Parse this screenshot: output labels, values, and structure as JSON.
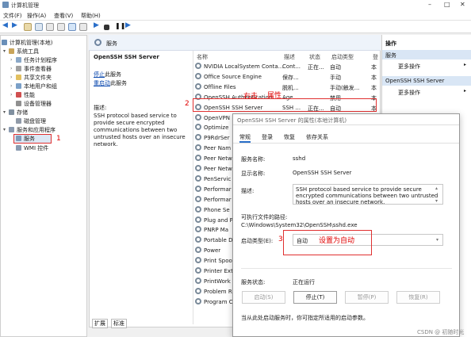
{
  "window": {
    "title": "计算机管理"
  },
  "menu": [
    "文件(F)",
    "操作(A)",
    "查看(V)",
    "帮助(H)"
  ],
  "tree": {
    "root": "计算机管理(本地)",
    "system_tools": "系统工具",
    "task_scheduler": "任务计划程序",
    "event_viewer": "事件查看器",
    "shared_folders": "共享文件夹",
    "local_users": "本地用户和组",
    "performance": "性能",
    "device_manager": "设备管理器",
    "storage": "存储",
    "disk_management": "磁盘管理",
    "services_apps": "服务和应用程序",
    "services": "服务",
    "wmi": "WMI 控件"
  },
  "center": {
    "header": "服务",
    "service_name": "OpenSSH SSH Server",
    "stop_link": "停止",
    "stop_suffix": "此服务",
    "restart_link": "重启动",
    "restart_suffix": "此服务",
    "desc_label": "描述:",
    "desc_text": "SSH protocol based service to provide secure encrypted communications between two untrusted hosts over an insecure network.",
    "columns": [
      "名称",
      "描述",
      "状态",
      "启动类型",
      "登"
    ],
    "rows": [
      {
        "name": "NVIDIA LocalSystem Conta...",
        "desc": "Cont...",
        "status": "正在...",
        "startup": "自动",
        "logon": "本"
      },
      {
        "name": "Office Source Engine",
        "desc": "保存...",
        "status": "",
        "startup": "手动",
        "logon": "本"
      },
      {
        "name": "Offline Files",
        "desc": "脱机...",
        "status": "",
        "startup": "手动(触发...",
        "logon": "本"
      },
      {
        "name": "OpenSSH Authentication...",
        "desc": "Age...",
        "status": "",
        "startup": "禁用",
        "logon": "本"
      },
      {
        "name": "OpenSSH SSH Server",
        "desc": "SSH ...",
        "status": "正在...",
        "startup": "自动",
        "logon": "本"
      },
      {
        "name": "OpenVPN",
        "desc": "",
        "status": "",
        "startup": "",
        "logon": ""
      },
      {
        "name": "Optimize",
        "desc": "",
        "status": "",
        "startup": "",
        "logon": ""
      },
      {
        "name": "P9RdrSer",
        "desc": "",
        "status": "",
        "startup": "",
        "logon": ""
      },
      {
        "name": "Peer Nam",
        "desc": "",
        "status": "",
        "startup": "",
        "logon": ""
      },
      {
        "name": "Peer Netw",
        "desc": "",
        "status": "",
        "startup": "",
        "logon": ""
      },
      {
        "name": "Peer Netw",
        "desc": "",
        "status": "",
        "startup": "",
        "logon": ""
      },
      {
        "name": "PenServic",
        "desc": "",
        "status": "",
        "startup": "",
        "logon": ""
      },
      {
        "name": "Performar",
        "desc": "",
        "status": "",
        "startup": "",
        "logon": ""
      },
      {
        "name": "Performar",
        "desc": "",
        "status": "",
        "startup": "",
        "logon": ""
      },
      {
        "name": "Phone Se",
        "desc": "",
        "status": "",
        "startup": "",
        "logon": ""
      },
      {
        "name": "Plug and P",
        "desc": "",
        "status": "",
        "startup": "",
        "logon": ""
      },
      {
        "name": "PNRP Ma",
        "desc": "",
        "status": "",
        "startup": "",
        "logon": ""
      },
      {
        "name": "Portable D",
        "desc": "",
        "status": "",
        "startup": "",
        "logon": ""
      },
      {
        "name": "Power",
        "desc": "",
        "status": "",
        "startup": "",
        "logon": ""
      },
      {
        "name": "Print Spoo",
        "desc": "",
        "status": "",
        "startup": "",
        "logon": ""
      },
      {
        "name": "Printer Ext",
        "desc": "",
        "status": "",
        "startup": "",
        "logon": ""
      },
      {
        "name": "PrintWork",
        "desc": "",
        "status": "",
        "startup": "",
        "logon": ""
      },
      {
        "name": "Problem R",
        "desc": "",
        "status": "",
        "startup": "",
        "logon": ""
      },
      {
        "name": "Program C",
        "desc": "",
        "status": "",
        "startup": "",
        "logon": ""
      }
    ],
    "tabs": [
      "扩展",
      "标准"
    ]
  },
  "actions": {
    "title": "操作",
    "section1": "服务",
    "more1": "更多操作",
    "section2": "OpenSSH SSH Server",
    "more2": "更多操作"
  },
  "dialog": {
    "title": "OpenSSH SSH Server 的属性(本地计算机)",
    "tabs": [
      "常规",
      "登录",
      "恢复",
      "依存关系"
    ],
    "service_name_label": "服务名称:",
    "service_name_value": "sshd",
    "display_name_label": "显示名称:",
    "display_name_value": "OpenSSH SSH Server",
    "desc_label": "描述:",
    "desc_value": "SSH protocol based service to provide secure encrypted communications between two untrusted hosts over an insecure network.",
    "path_label": "可执行文件的路径:",
    "path_value": "C:\\Windows\\System32\\OpenSSH\\sshd.exe",
    "startup_label": "启动类型(E):",
    "startup_value": "自动",
    "status_label": "服务状态:",
    "status_value": "正在运行",
    "btn_start": "启动(S)",
    "btn_stop": "停止(T)",
    "btn_pause": "暂停(P)",
    "btn_resume": "恢复(R)",
    "hint": "当从此处启动服务时，你可指定所适用的启动参数。"
  },
  "annotations": {
    "n1": "1",
    "n2": "2",
    "n3": "3",
    "right_click": "右击",
    "properties": "属性",
    "set_auto": "设置为自动"
  },
  "watermark": "CSDN @ 初随时光",
  "colors": {
    "annotation": "#e00000",
    "selection": "#cce4f7",
    "header_blue": "#d9e6f5"
  }
}
